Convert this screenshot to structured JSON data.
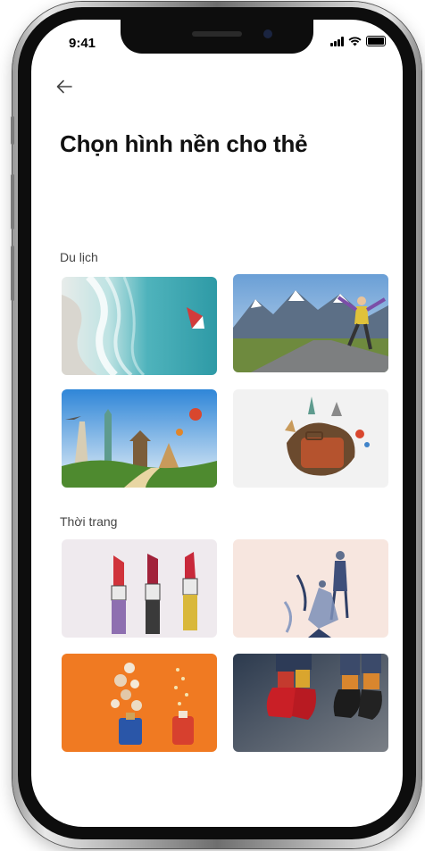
{
  "status_bar": {
    "time": "9:41"
  },
  "nav": {
    "back_icon": "arrow-left-icon"
  },
  "page": {
    "title": "Chọn hình nền cho thẻ"
  },
  "sections": [
    {
      "label": "Du lịch",
      "images": [
        "ocean-aerial-boat",
        "mountain-road-jumper",
        "world-landmarks-balloons",
        "suitcase-landmarks"
      ]
    },
    {
      "label": "Thời trang",
      "images": [
        "lipsticks",
        "fashion-sketch-figures",
        "perfume-orange",
        "red-shoes-socks"
      ]
    }
  ]
}
